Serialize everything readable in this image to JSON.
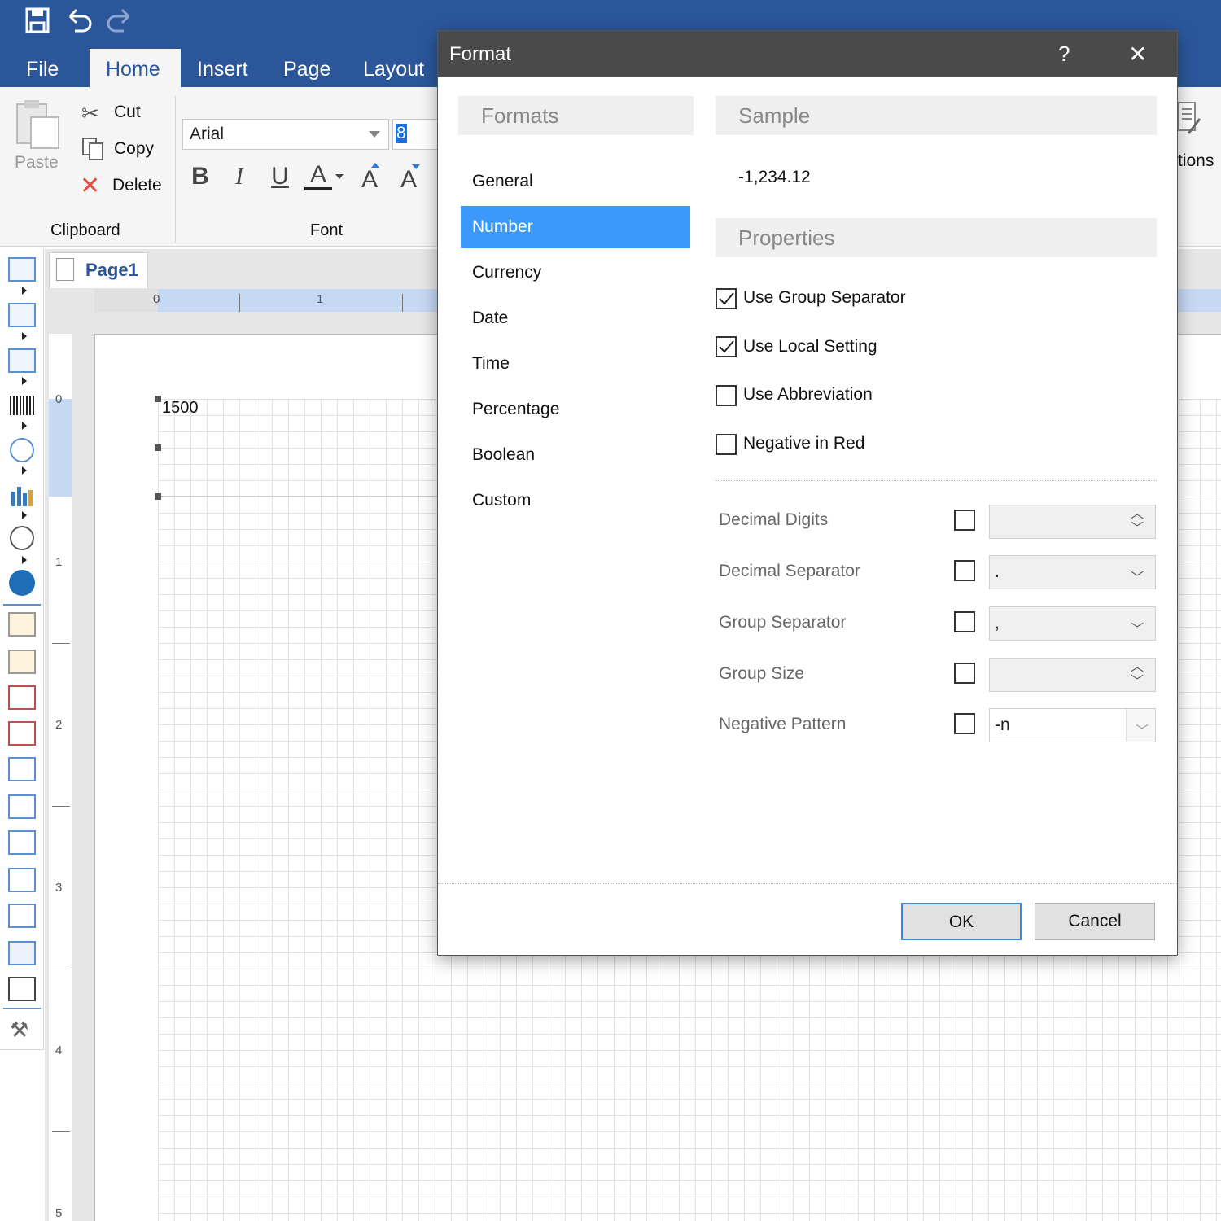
{
  "quick_access": {
    "save_icon": "save-icon",
    "undo_icon": "undo-icon",
    "redo_icon": "redo-icon"
  },
  "tabs": [
    {
      "label": "File",
      "active": false
    },
    {
      "label": "Home",
      "active": true
    },
    {
      "label": "Insert",
      "active": false
    },
    {
      "label": "Page",
      "active": false
    },
    {
      "label": "Layout",
      "active": false
    }
  ],
  "ribbon": {
    "paste_label": "Paste",
    "cut_label": "Cut",
    "copy_label": "Copy",
    "delete_label": "Delete",
    "clipboard_group": "Clipboard",
    "font_name": "Arial",
    "font_size": "8",
    "font_group": "Font",
    "options_partial": "tions",
    "bold": "B",
    "italic": "I",
    "underline": "U",
    "font_color": "A",
    "grow": "A",
    "shrink": "A"
  },
  "designer": {
    "page_tab": "Page1",
    "hruler_ticks": [
      "0",
      "1"
    ],
    "vruler_ticks": [
      "0",
      "1",
      "2",
      "3",
      "4",
      "5"
    ],
    "textbox_value": "1500"
  },
  "dialog": {
    "title": "Format",
    "help": "?",
    "close": "✕",
    "formats_header": "Formats",
    "formats": [
      "General",
      "Number",
      "Currency",
      "Date",
      "Time",
      "Percentage",
      "Boolean",
      "Custom"
    ],
    "selected_format": "Number",
    "sample_header": "Sample",
    "sample_value": "-1,234.12",
    "properties_header": "Properties",
    "checkboxes": [
      {
        "label": "Use Group Separator",
        "checked": true
      },
      {
        "label": "Use Local Setting",
        "checked": true
      },
      {
        "label": "Use Abbreviation",
        "checked": false
      },
      {
        "label": "Negative in Red",
        "checked": false
      }
    ],
    "properties": [
      {
        "label": "Decimal Digits",
        "value": "",
        "kind": "spinner"
      },
      {
        "label": "Decimal Separator",
        "value": ".",
        "kind": "dropdown"
      },
      {
        "label": "Group Separator",
        "value": ",",
        "kind": "dropdown"
      },
      {
        "label": "Group Size",
        "value": "",
        "kind": "spinner"
      },
      {
        "label": "Negative Pattern",
        "value": "-n",
        "kind": "dropdown"
      }
    ],
    "ok_label": "OK",
    "cancel_label": "Cancel"
  },
  "colors": {
    "brand": "#2b579a",
    "selection": "#3b99fc",
    "dialog_title": "#4a4a4a"
  }
}
